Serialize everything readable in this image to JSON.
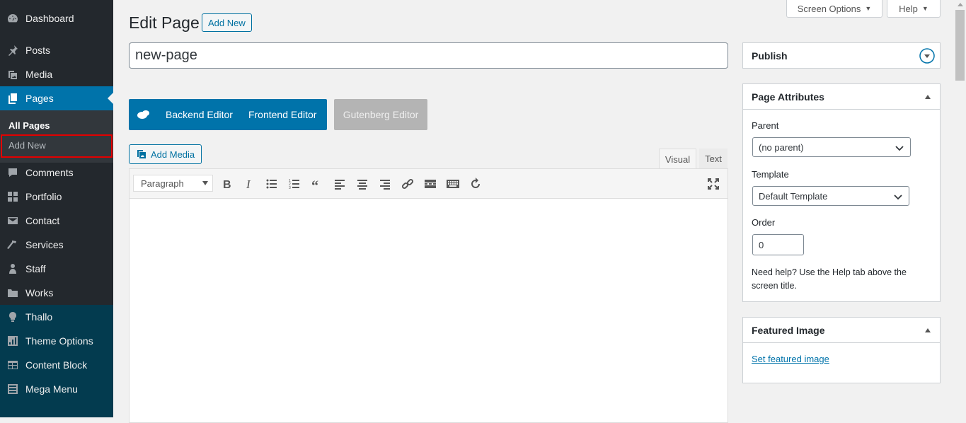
{
  "sidebar": {
    "items": [
      {
        "label": "Dashboard",
        "icon": "dashboard-icon"
      },
      {
        "label": "Posts",
        "icon": "pin-icon"
      },
      {
        "label": "Media",
        "icon": "media-icon"
      },
      {
        "label": "Pages",
        "icon": "pages-icon"
      },
      {
        "label": "Comments",
        "icon": "comments-icon"
      },
      {
        "label": "Portfolio",
        "icon": "portfolio-icon"
      },
      {
        "label": "Contact",
        "icon": "mail-icon"
      },
      {
        "label": "Services",
        "icon": "hammer-icon"
      },
      {
        "label": "Staff",
        "icon": "user-icon"
      },
      {
        "label": "Works",
        "icon": "folder-icon"
      },
      {
        "label": "Thallo",
        "icon": "lightbulb-icon"
      },
      {
        "label": "Theme Options",
        "icon": "theme-options-icon"
      },
      {
        "label": "Content Block",
        "icon": "table-icon"
      },
      {
        "label": "Mega Menu",
        "icon": "list-icon"
      }
    ],
    "submenu": {
      "all_pages": "All Pages",
      "add_new": "Add New"
    }
  },
  "top": {
    "screen_options": "Screen Options",
    "help": "Help"
  },
  "header": {
    "title": "Edit Page",
    "add_new": "Add New"
  },
  "title_field": {
    "value": "new-page"
  },
  "editor_switch": {
    "backend": "Backend Editor",
    "frontend": "Frontend Editor",
    "gutenberg": "Gutenberg Editor"
  },
  "media": {
    "add_media": "Add Media"
  },
  "tabs": {
    "visual": "Visual",
    "text": "Text"
  },
  "toolbar": {
    "format": "Paragraph"
  },
  "publish": {
    "title": "Publish"
  },
  "attributes": {
    "title": "Page Attributes",
    "parent_label": "Parent",
    "parent_value": "(no parent)",
    "template_label": "Template",
    "template_value": "Default Template",
    "order_label": "Order",
    "order_value": "0",
    "help_line1": "Need help? Use the Help tab above the",
    "help_line2": "screen title."
  },
  "featured": {
    "title": "Featured Image",
    "link": "Set featured image"
  },
  "colors": {
    "accent": "#0073aa",
    "sidebar_bg": "#23282d",
    "highlight": "#e30000"
  }
}
